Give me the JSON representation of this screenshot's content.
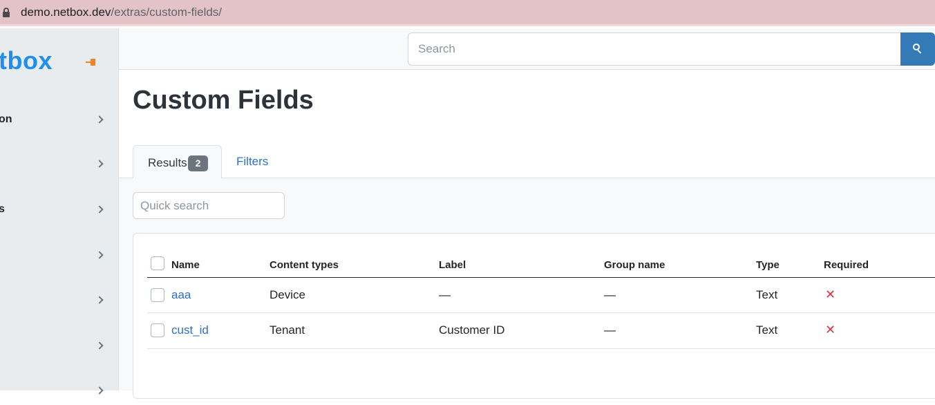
{
  "browser": {
    "url_host": "demo.netbox.dev",
    "url_path": "/extras/custom-fields/"
  },
  "sidebar": {
    "logo": "tbox",
    "items": [
      {
        "label": "on"
      },
      {
        "label": ""
      },
      {
        "label": "s"
      },
      {
        "label": ""
      },
      {
        "label": ""
      },
      {
        "label": ""
      },
      {
        "label": ""
      }
    ]
  },
  "topbar": {
    "search_placeholder": "Search"
  },
  "page": {
    "title": "Custom Fields"
  },
  "tabs": {
    "results_label": "Results",
    "results_count": "2",
    "filters_label": "Filters"
  },
  "quick_search": {
    "placeholder": "Quick search"
  },
  "table": {
    "headers": {
      "name": "Name",
      "content_types": "Content types",
      "label": "Label",
      "group_name": "Group name",
      "type": "Type",
      "required": "Required"
    },
    "rows": [
      {
        "name": "aaa",
        "content_types": "Device",
        "label": "—",
        "group_name": "—",
        "type": "Text",
        "required": "✕"
      },
      {
        "name": "cust_id",
        "content_types": "Tenant",
        "label": "Customer ID",
        "group_name": "—",
        "type": "Text",
        "required": "✕"
      }
    ]
  },
  "colors": {
    "accent": "#337ab7",
    "link": "#2f6fc8",
    "false_mark": "#dc3545",
    "logo": "#1e8fef"
  }
}
